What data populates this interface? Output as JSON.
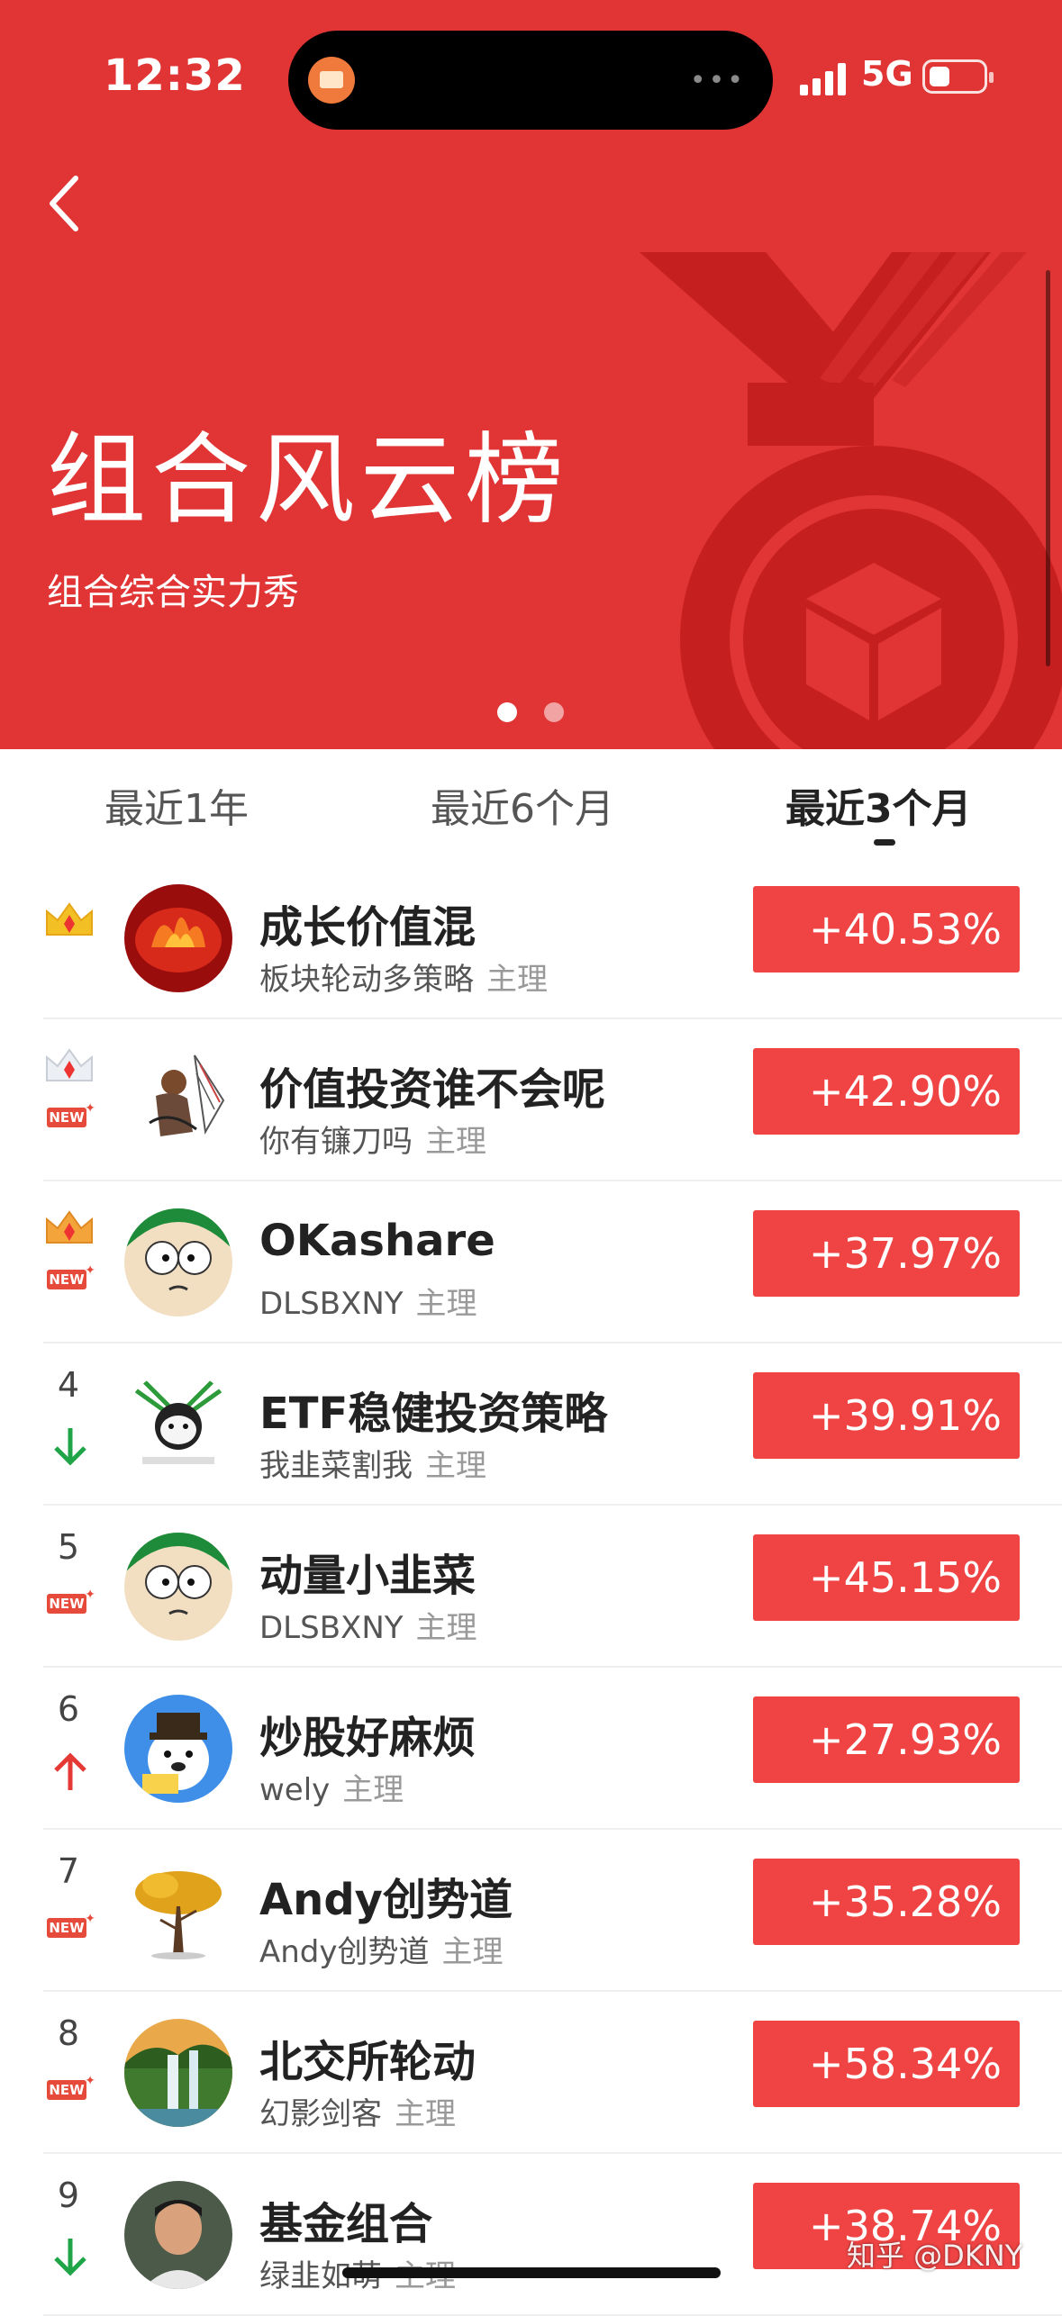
{
  "status_bar": {
    "time": "12:32",
    "network": "5G"
  },
  "hero": {
    "title": "组合风云榜",
    "subtitle": "组合综合实力秀",
    "background_color": "#e13434"
  },
  "tabs": [
    {
      "label": "最近1年",
      "active": false
    },
    {
      "label": "最近6个月",
      "active": false
    },
    {
      "label": "最近3个月",
      "active": true
    }
  ],
  "list": [
    {
      "rank": "",
      "badge": "crown-gold",
      "new": false,
      "trend": "",
      "name": "成长价值混",
      "author": "板块轮动多策略",
      "role": "主理",
      "return": "+40.53%",
      "avatar": "fire"
    },
    {
      "rank": "",
      "badge": "crown-silver",
      "new": true,
      "trend": "",
      "name": "价值投资谁不会呢",
      "author": "你有镰刀吗",
      "role": "主理",
      "return": "+42.90%",
      "avatar": "anime"
    },
    {
      "rank": "",
      "badge": "crown-bronze",
      "new": true,
      "trend": "",
      "name": "OKashare",
      "author": "DLSBXNY",
      "role": "主理",
      "return": "+37.97%",
      "avatar": "cartoon"
    },
    {
      "rank": "4",
      "badge": "",
      "new": false,
      "trend": "down",
      "name": "ETF稳健投资策略",
      "author": "我韭菜割我",
      "role": "主理",
      "return": "+39.91%",
      "avatar": "meme"
    },
    {
      "rank": "5",
      "badge": "",
      "new": true,
      "trend": "",
      "name": "动量小韭菜",
      "author": "DLSBXNY",
      "role": "主理",
      "return": "+45.15%",
      "avatar": "cartoon"
    },
    {
      "rank": "6",
      "badge": "",
      "new": false,
      "trend": "up",
      "name": "炒股好麻烦",
      "author": "wely",
      "role": "主理",
      "return": "+27.93%",
      "avatar": "bear"
    },
    {
      "rank": "7",
      "badge": "",
      "new": true,
      "trend": "",
      "name": "Andy创势道",
      "author": "Andy创势道",
      "role": "主理",
      "return": "+35.28%",
      "avatar": "tree"
    },
    {
      "rank": "8",
      "badge": "",
      "new": true,
      "trend": "",
      "name": "北交所轮动",
      "author": "幻影剑客",
      "role": "主理",
      "return": "+58.34%",
      "avatar": "waterfall"
    },
    {
      "rank": "9",
      "badge": "",
      "new": false,
      "trend": "down",
      "name": "基金组合",
      "author": "绿韭如萌",
      "role": "主理",
      "return": "+38.74%",
      "avatar": "person"
    }
  ],
  "badges": {
    "new": "NEW"
  },
  "watermark": "知乎 @DKNY",
  "colors": {
    "return_bg": "#f04444",
    "trend_up": "#e53935",
    "trend_down": "#1fa547"
  }
}
